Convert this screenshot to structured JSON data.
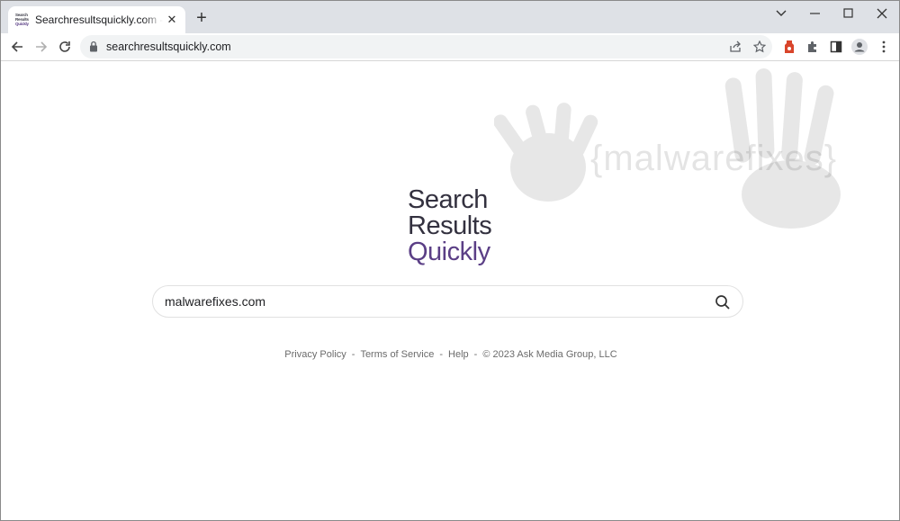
{
  "browser": {
    "tab_title": "Searchresultsquickly.com - What",
    "favicon_lines": [
      "Search",
      "Results",
      "Quickly"
    ],
    "url": "searchresultsquickly.com"
  },
  "page": {
    "watermark_text": "{malwarefixes}",
    "logo": {
      "line1": "Search",
      "line2": "Results",
      "line3": "Quickly"
    },
    "search": {
      "value": "malwarefixes.com"
    },
    "footer": {
      "privacy": "Privacy Policy",
      "terms": "Terms of Service",
      "help": "Help",
      "copyright": "© 2023 Ask Media Group, LLC",
      "separator": "-"
    }
  },
  "colors": {
    "brand_dark": "#33313f",
    "brand_purple": "#5b3f86",
    "tabstrip": "#dee1e6"
  }
}
